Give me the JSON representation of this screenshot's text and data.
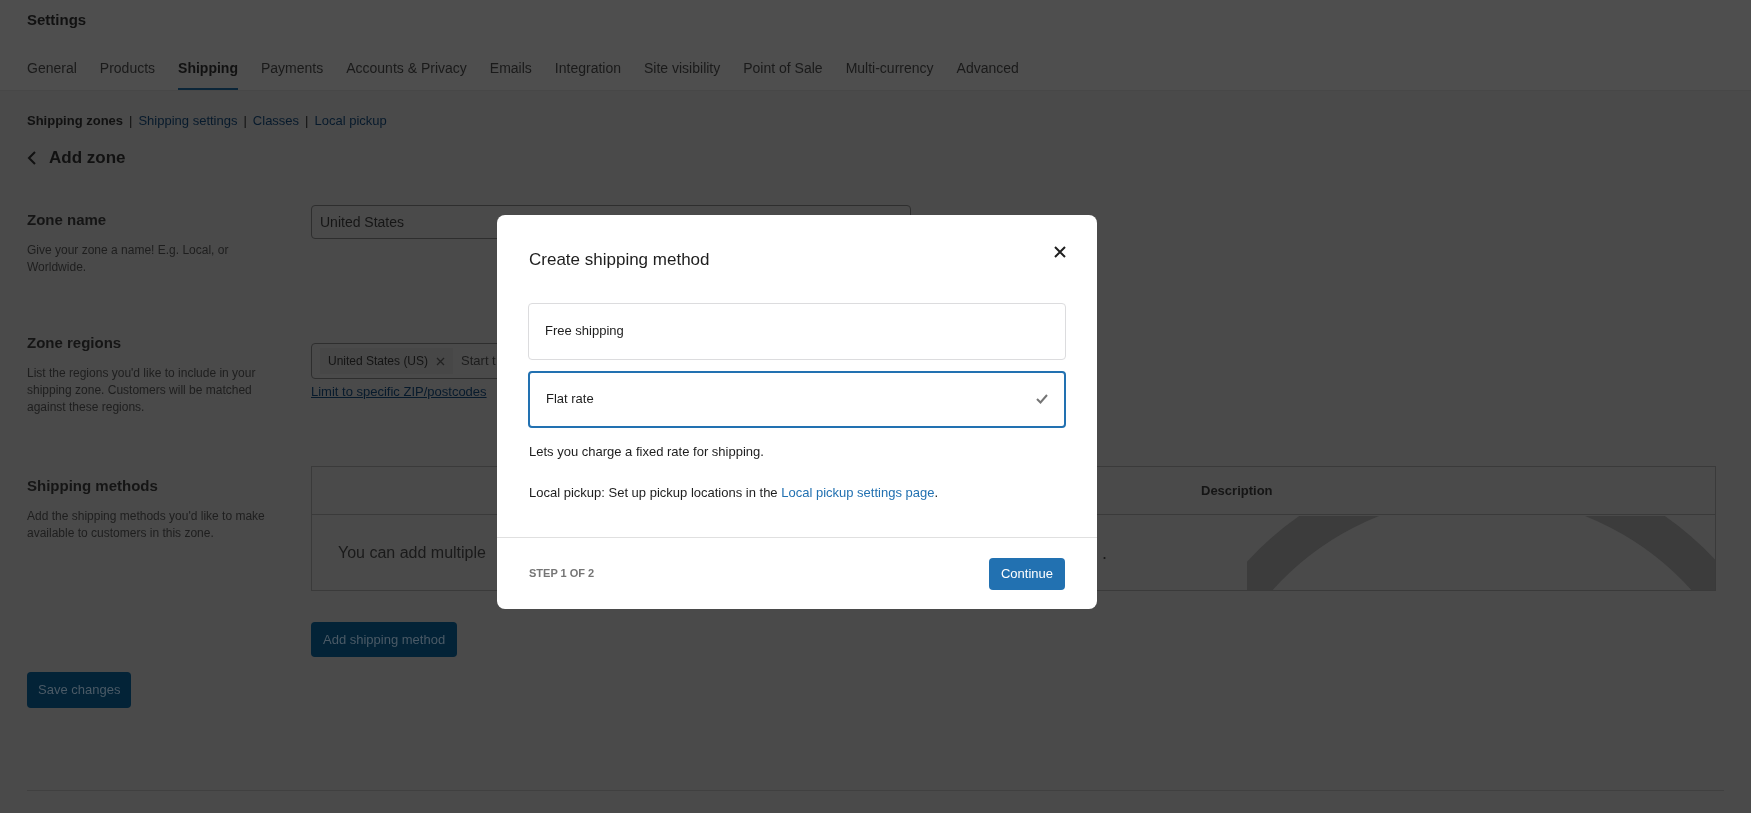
{
  "header": {
    "title": "Settings"
  },
  "tabs": [
    {
      "label": "General",
      "selected": false
    },
    {
      "label": "Products",
      "selected": false
    },
    {
      "label": "Shipping",
      "selected": true
    },
    {
      "label": "Payments",
      "selected": false
    },
    {
      "label": "Accounts & Privacy",
      "selected": false
    },
    {
      "label": "Emails",
      "selected": false
    },
    {
      "label": "Integration",
      "selected": false
    },
    {
      "label": "Site visibility",
      "selected": false
    },
    {
      "label": "Point of Sale",
      "selected": false
    },
    {
      "label": "Multi-currency",
      "selected": false
    },
    {
      "label": "Advanced",
      "selected": false
    }
  ],
  "subnav_separator": "|",
  "subnav": [
    {
      "label": "Shipping zones",
      "selected": true
    },
    {
      "label": "Shipping settings",
      "selected": false
    },
    {
      "label": "Classes",
      "selected": false
    },
    {
      "label": "Local pickup",
      "selected": false
    }
  ],
  "page_title": "Add zone",
  "zone_name": {
    "label": "Zone name",
    "help": "Give your zone a name! E.g. Local, or Worldwide.",
    "value": "United States"
  },
  "zone_regions": {
    "label": "Zone regions",
    "help": "List the regions you'd like to include in your shipping zone. Customers will be matched against these regions.",
    "tags": [
      "United States (US)"
    ],
    "placeholder": "Start t",
    "link": "Limit to specific ZIP/postcodes"
  },
  "shipping_methods": {
    "label": "Shipping methods",
    "help": "Add the shipping methods you'd like to make available to customers in this zone.",
    "columns": [
      "Description"
    ],
    "empty_text_start": "You can add multiple",
    "empty_text_end": ".",
    "add_button": "Add shipping method"
  },
  "save_button": "Save changes",
  "modal": {
    "title": "Create shipping method",
    "options": [
      {
        "label": "Free shipping",
        "selected": false
      },
      {
        "label": "Flat rate",
        "selected": true
      }
    ],
    "description": "Lets you charge a fixed rate for shipping.",
    "note": "Local pickup: Set up pickup locations in the",
    "note_link": "Local pickup settings page",
    "note_end": ".",
    "step": "STEP 1 OF 2",
    "continue_button": "Continue"
  }
}
